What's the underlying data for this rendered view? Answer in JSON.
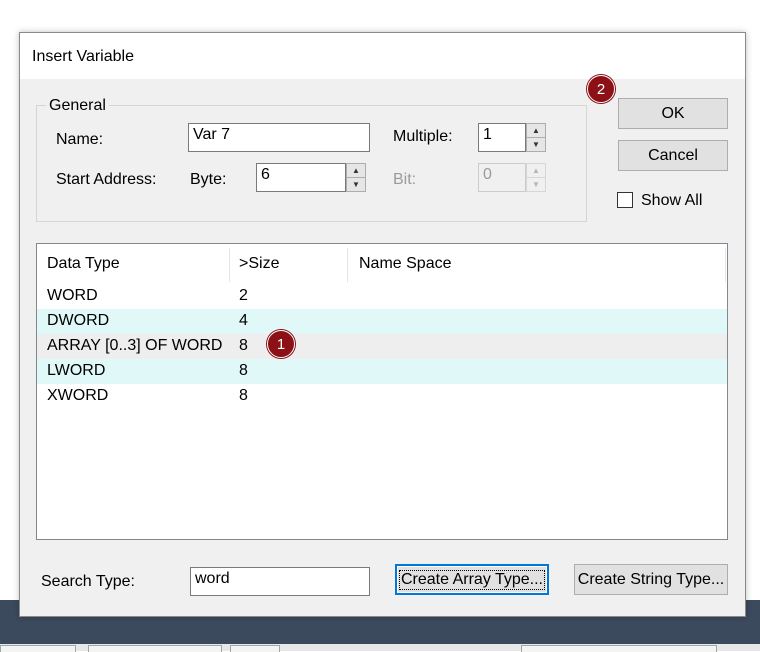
{
  "dialog": {
    "title": "Insert Variable",
    "general": {
      "legend": "General",
      "name_label": "Name:",
      "name_value": "Var 7",
      "multiple_label": "Multiple:",
      "multiple_value": "1",
      "start_address_label": "Start Address:",
      "byte_label": "Byte:",
      "byte_value": "6",
      "bit_label": "Bit:",
      "bit_value": "0"
    },
    "buttons": {
      "ok": "OK",
      "cancel": "Cancel",
      "create_array": "Create Array Type...",
      "create_string": "Create String Type..."
    },
    "show_all_label": "Show All",
    "show_all_checked": false,
    "search_label": "Search Type:",
    "search_value": "word"
  },
  "list": {
    "columns": [
      "Data Type",
      ">Size",
      "Name Space"
    ],
    "rows": [
      {
        "type": "WORD",
        "size": "2",
        "namespace": ""
      },
      {
        "type": "DWORD",
        "size": "4",
        "namespace": ""
      },
      {
        "type": "ARRAY [0..3] OF WORD",
        "size": "8",
        "namespace": ""
      },
      {
        "type": "LWORD",
        "size": "8",
        "namespace": ""
      },
      {
        "type": "XWORD",
        "size": "8",
        "namespace": ""
      }
    ]
  },
  "annotations": {
    "badge_1": "1",
    "badge_2": "2",
    "badge_color": "#8b1116"
  },
  "colors": {
    "alt_row": "#e0f8f8",
    "selected_row": "#eeeeee",
    "focus_border": "#0078d7"
  }
}
